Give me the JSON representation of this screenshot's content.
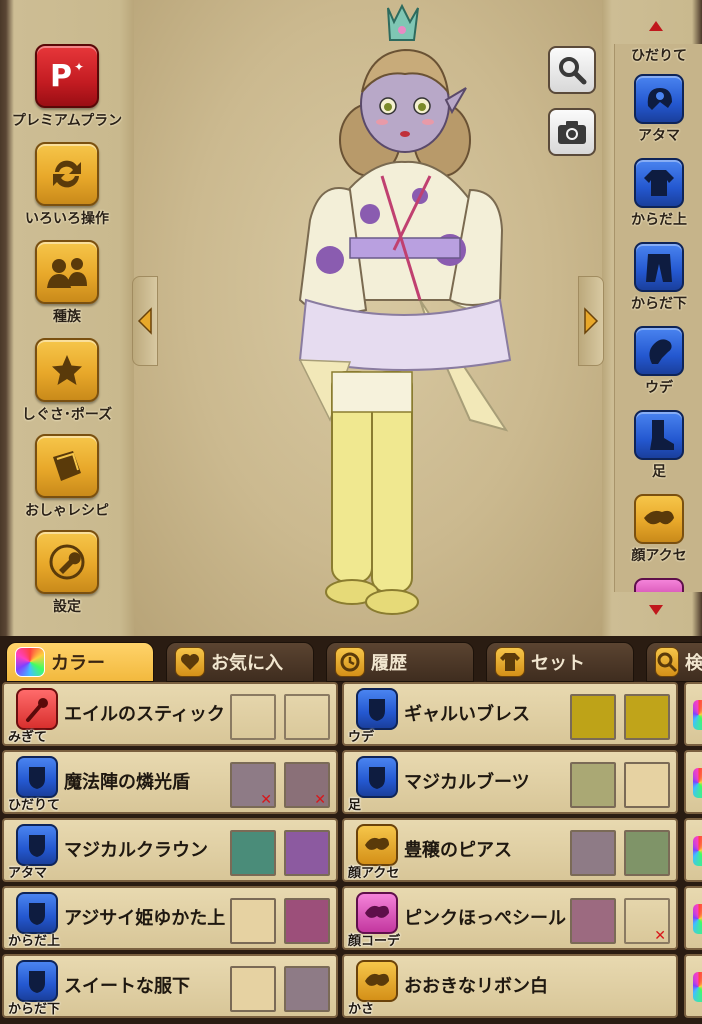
{
  "left_menu": [
    {
      "label": "プレミアムプラン",
      "icon": "premium-p-icon",
      "icon_text": "P"
    },
    {
      "label": "いろいろ操作",
      "icon": "refresh-arrows-icon"
    },
    {
      "label": "種族",
      "icon": "race-change-icon"
    },
    {
      "label": "しぐさ･ポーズ",
      "icon": "star-icon"
    },
    {
      "label": "おしゃレシピ",
      "icon": "recipe-book-icon"
    },
    {
      "label": "設定",
      "icon": "wrench-icon"
    }
  ],
  "right_menu": [
    {
      "label": "ひだりて",
      "icon": "shield-icon"
    },
    {
      "label": "アタマ",
      "icon": "helmet-icon"
    },
    {
      "label": "からだ上",
      "icon": "shirt-icon"
    },
    {
      "label": "からだ下",
      "icon": "pants-icon"
    },
    {
      "label": "ウデ",
      "icon": "gauntlet-icon"
    },
    {
      "label": "足",
      "icon": "boot-icon"
    },
    {
      "label": "顔アクセ",
      "icon": "face-accessory-icon"
    }
  ],
  "tabs": [
    {
      "label": "カラー",
      "icon": "rainbow-palette-icon",
      "active": true
    },
    {
      "label": "お気に入",
      "icon": "heart-icon",
      "active": false
    },
    {
      "label": "履歴",
      "icon": "history-clock-icon",
      "active": false
    },
    {
      "label": "セット",
      "icon": "outfit-set-icon",
      "active": false
    },
    {
      "label": "検",
      "icon": "search-icon",
      "active": false
    }
  ],
  "equipment_left": [
    {
      "slot": "みぎて",
      "name": "エイルのスティック",
      "icon_color": "red",
      "swatches": [
        "empty",
        "empty"
      ],
      "x_marks": [
        false,
        false
      ]
    },
    {
      "slot": "ひだりて",
      "name": "魔法陣の燐光盾",
      "icon_color": "blue",
      "swatches": [
        "#8e7b86",
        "#8a7078"
      ],
      "x_marks": [
        true,
        true
      ]
    },
    {
      "slot": "アタマ",
      "name": "マジカルクラウン",
      "icon_color": "blue",
      "swatches": [
        "#4a8c79",
        "#8c5aa0"
      ],
      "x_marks": [
        false,
        false
      ]
    },
    {
      "slot": "からだ上",
      "name": "アジサイ姫ゆかた上",
      "icon_color": "blue",
      "swatches": [
        "#e6d2a2",
        "#9c4f7a"
      ],
      "x_marks": [
        false,
        false
      ]
    },
    {
      "slot": "からだ下",
      "name": "スイートな服下",
      "icon_color": "blue",
      "swatches": [
        "#e6d2a2",
        "#8e7b86"
      ],
      "x_marks": [
        false,
        false
      ]
    }
  ],
  "equipment_right": [
    {
      "slot": "ウデ",
      "name": "ギャルいブレス",
      "icon_color": "blue",
      "swatches": [
        "#bea318",
        "#c0a41a"
      ],
      "x_marks": [
        false,
        false
      ]
    },
    {
      "slot": "足",
      "name": "マジカルブーツ",
      "icon_color": "blue",
      "swatches": [
        "#aaa874",
        "#e6d2a2"
      ],
      "x_marks": [
        false,
        false
      ]
    },
    {
      "slot": "顔アクセ",
      "name": "豊穣のピアス",
      "icon_color": "gold",
      "swatches": [
        "#8e7b86",
        "#7f9468"
      ],
      "x_marks": [
        false,
        false
      ]
    },
    {
      "slot": "顔コーデ",
      "name": "ピンクほっぺシール",
      "icon_color": "pink",
      "swatches": [
        "#9c6a80",
        "empty"
      ],
      "x_marks": [
        false,
        true
      ]
    },
    {
      "slot": "かさ",
      "name": "おおきなリボン白",
      "icon_color": "gold",
      "swatches": [],
      "x_marks": []
    }
  ],
  "colors": {
    "gold_button": "#e8a82a",
    "blue_slot": "#2458d0",
    "active_tab": "#f2b93e",
    "parchment": "#cbb98f"
  }
}
